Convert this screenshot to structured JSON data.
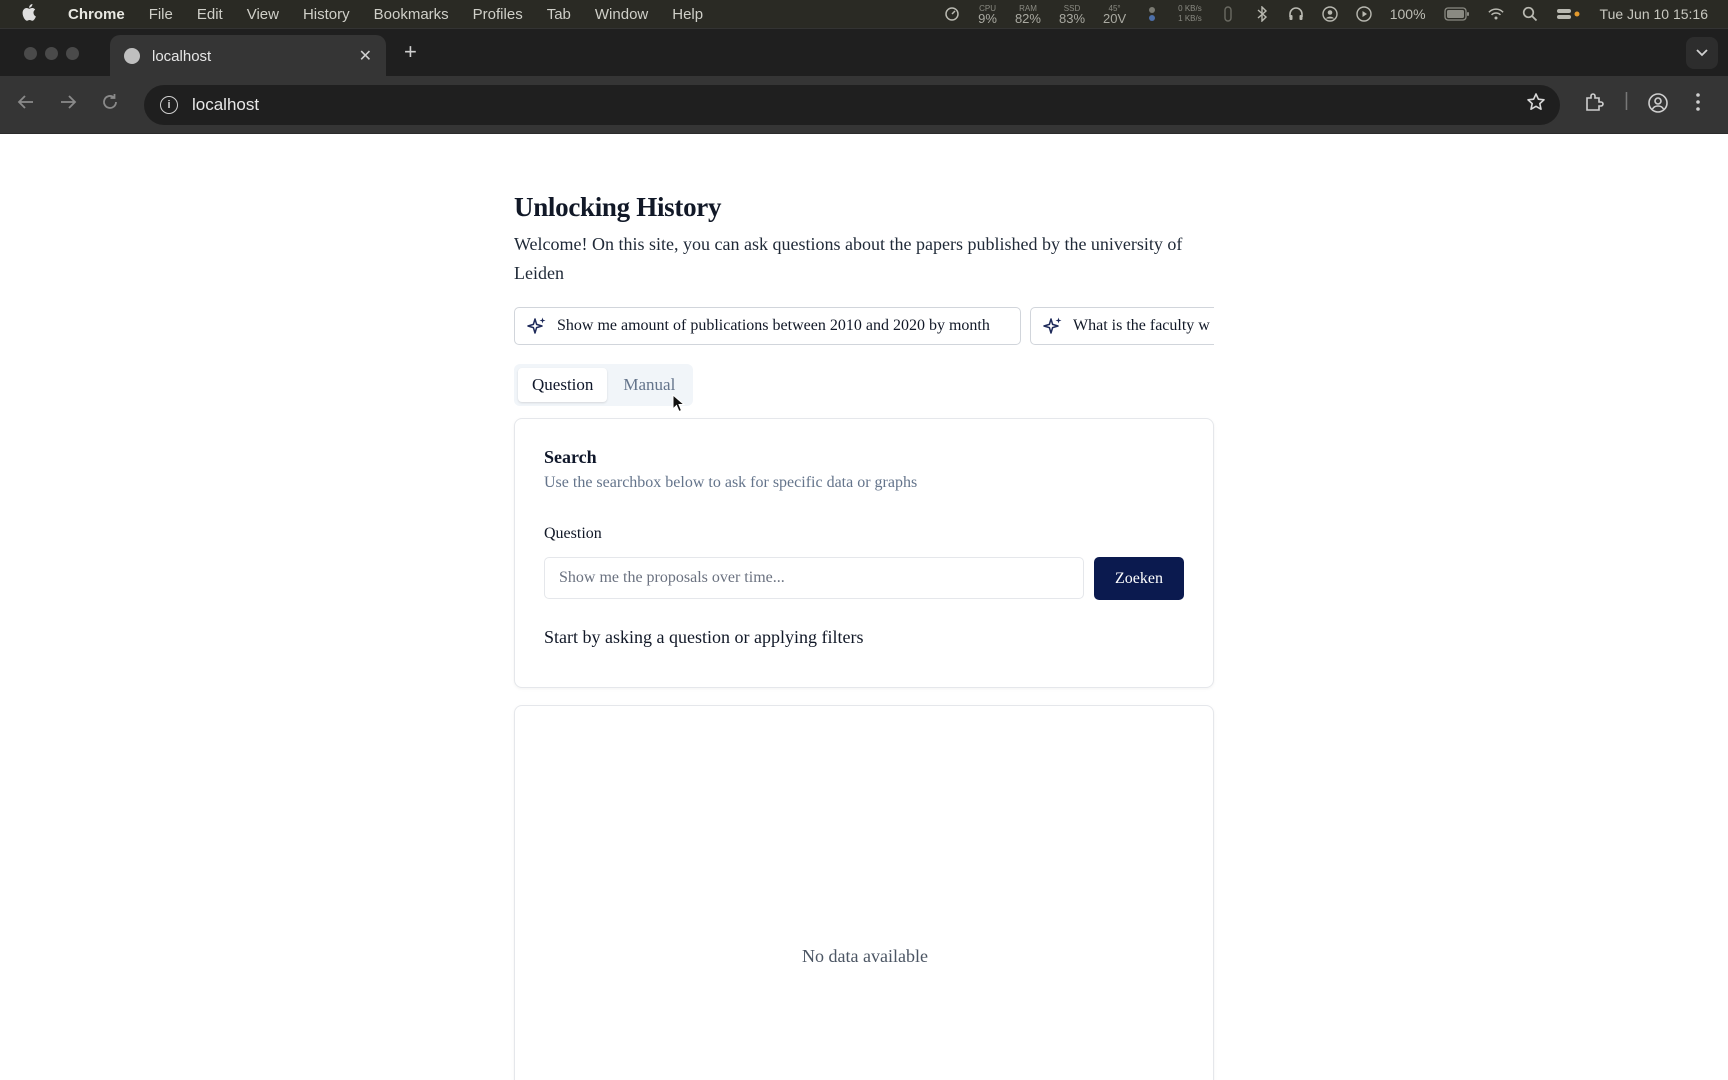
{
  "menubar": {
    "app": "Chrome",
    "items": [
      "File",
      "Edit",
      "View",
      "History",
      "Bookmarks",
      "Profiles",
      "Tab",
      "Window",
      "Help"
    ],
    "stats": [
      {
        "label": "CPU",
        "value": "9%"
      },
      {
        "label": "RAM",
        "value": "82%"
      },
      {
        "label": "SSD",
        "value": "83%"
      },
      {
        "label": "45°",
        "value": "20V"
      }
    ],
    "net_up": "0 KB/s",
    "net_down": "1 KB/s",
    "battery": "100%",
    "clock": "Tue Jun 10  15:16"
  },
  "browser": {
    "tab_title": "localhost",
    "url": "localhost"
  },
  "page": {
    "title": "Unlocking History",
    "welcome": "Welcome! On this site, you can ask questions about the papers published by the university of Leiden",
    "suggestions": [
      "Show me amount of publications between 2010 and 2020 by month",
      "What is the faculty w"
    ],
    "tabs": [
      "Question",
      "Manual"
    ],
    "active_tab": "Question",
    "search": {
      "title": "Search",
      "description": "Use the searchbox below to ask for specific data or graphs",
      "question_label": "Question",
      "placeholder": "Show me the proposals over time...",
      "submit_label": "Zoeken",
      "hint": "Start by asking a question or applying filters"
    },
    "result": {
      "empty_text": "No data available"
    }
  },
  "colors": {
    "accent": "#0b1a4f",
    "menubar_bg": "#2a2a24",
    "browser_chrome": "#353535"
  }
}
